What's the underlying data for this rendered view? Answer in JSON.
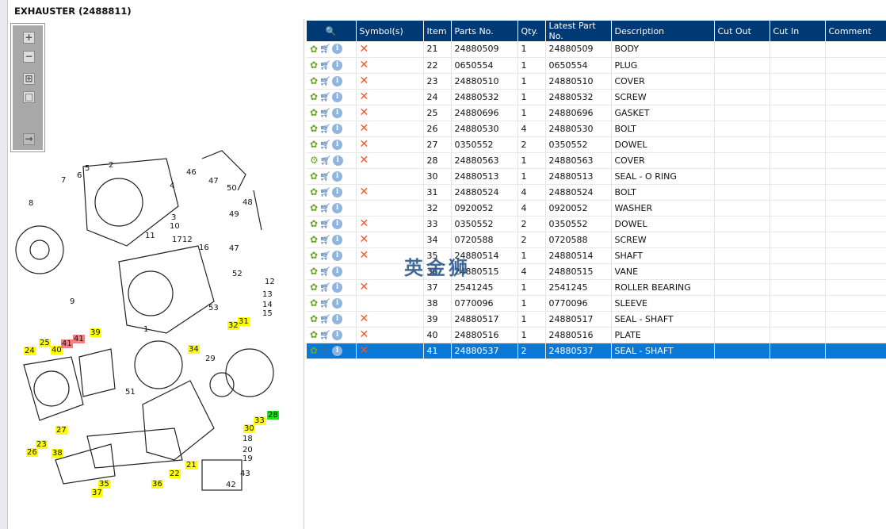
{
  "title": "EXHAUSTER (2488811)",
  "toolbar": [
    {
      "icon": "zoom-in-icon"
    },
    {
      "icon": "zoom-out-icon"
    },
    {
      "icon": "fit-all-icon"
    },
    {
      "icon": "actual-size-icon"
    },
    {
      "icon": "export-icon"
    }
  ],
  "watermark": "英金狮",
  "columns": [
    "",
    "Symbol(s)",
    "Item",
    "Parts No.",
    "Qty.",
    "Latest Part No.",
    "Description",
    "Cut Out",
    "Cut In",
    "Comment"
  ],
  "rows": [
    {
      "item": "21",
      "parts": "24880509",
      "qty": "1",
      "latest": "24880509",
      "desc": "BODY",
      "x": true
    },
    {
      "item": "22",
      "parts": "0650554",
      "qty": "1",
      "latest": "0650554",
      "desc": "PLUG",
      "x": true
    },
    {
      "item": "23",
      "parts": "24880510",
      "qty": "1",
      "latest": "24880510",
      "desc": "COVER",
      "x": true
    },
    {
      "item": "24",
      "parts": "24880532",
      "qty": "1",
      "latest": "24880532",
      "desc": "SCREW",
      "x": true
    },
    {
      "item": "25",
      "parts": "24880696",
      "qty": "1",
      "latest": "24880696",
      "desc": "GASKET",
      "x": true
    },
    {
      "item": "26",
      "parts": "24880530",
      "qty": "4",
      "latest": "24880530",
      "desc": "BOLT",
      "x": true
    },
    {
      "item": "27",
      "parts": "0350552",
      "qty": "2",
      "latest": "0350552",
      "desc": "DOWEL",
      "x": true
    },
    {
      "item": "28",
      "parts": "24880563",
      "qty": "1",
      "latest": "24880563",
      "desc": "COVER",
      "x": true,
      "gears": true
    },
    {
      "item": "30",
      "parts": "24880513",
      "qty": "1",
      "latest": "24880513",
      "desc": "SEAL - O RING",
      "x": false
    },
    {
      "item": "31",
      "parts": "24880524",
      "qty": "4",
      "latest": "24880524",
      "desc": "BOLT",
      "x": true
    },
    {
      "item": "32",
      "parts": "0920052",
      "qty": "4",
      "latest": "0920052",
      "desc": "WASHER",
      "x": false
    },
    {
      "item": "33",
      "parts": "0350552",
      "qty": "2",
      "latest": "0350552",
      "desc": "DOWEL",
      "x": true
    },
    {
      "item": "34",
      "parts": "0720588",
      "qty": "2",
      "latest": "0720588",
      "desc": "SCREW",
      "x": true
    },
    {
      "item": "35",
      "parts": "24880514",
      "qty": "1",
      "latest": "24880514",
      "desc": "SHAFT",
      "x": true
    },
    {
      "item": "36",
      "parts": "24880515",
      "qty": "4",
      "latest": "24880515",
      "desc": "VANE",
      "x": false
    },
    {
      "item": "37",
      "parts": "2541245",
      "qty": "1",
      "latest": "2541245",
      "desc": "ROLLER BEARING",
      "x": true
    },
    {
      "item": "38",
      "parts": "0770096",
      "qty": "1",
      "latest": "0770096",
      "desc": "SLEEVE",
      "x": false
    },
    {
      "item": "39",
      "parts": "24880517",
      "qty": "1",
      "latest": "24880517",
      "desc": "SEAL - SHAFT",
      "x": true
    },
    {
      "item": "40",
      "parts": "24880516",
      "qty": "1",
      "latest": "24880516",
      "desc": "PLATE",
      "x": true
    },
    {
      "item": "41",
      "parts": "24880537",
      "qty": "2",
      "latest": "24880537",
      "desc": "SEAL - SHAFT",
      "x": true,
      "selected": true
    }
  ],
  "callouts": [
    "24",
    "25",
    "40",
    "41",
    "41",
    "39",
    "34",
    "32",
    "31",
    "33",
    "28",
    "30",
    "23",
    "27",
    "26",
    "38",
    "35",
    "37",
    "36",
    "22",
    "21",
    "2",
    "5",
    "6",
    "7",
    "3",
    "4",
    "8",
    "9",
    "1",
    "10",
    "11",
    "17",
    "12",
    "16",
    "46",
    "47",
    "50",
    "49",
    "48",
    "47",
    "52",
    "53",
    "12",
    "14",
    "15",
    "13",
    "29",
    "51",
    "18",
    "20",
    "19",
    "43",
    "42"
  ],
  "callout_colors": {
    "highlight": "#ffff00",
    "alert": "#f08080",
    "selected": "#22dd22"
  },
  "colors": {
    "header": "#003a75",
    "selected_row": "#0a78d7"
  }
}
